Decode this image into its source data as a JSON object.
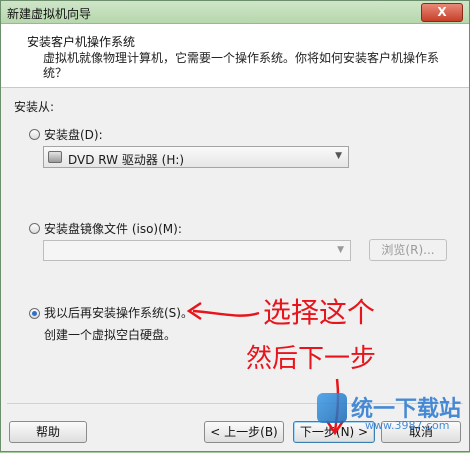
{
  "window": {
    "title": "新建虚拟机向导",
    "close_label": "X"
  },
  "header": {
    "title": "安装客户机操作系统",
    "description": "虚拟机就像物理计算机，它需要一个操作系统。你将如何安装客户机操作系统？"
  },
  "install_from": {
    "label": "安装从:",
    "disc_option": {
      "label": "安装盘(D):",
      "checked": false
    },
    "disc_drive": {
      "selected": "DVD RW 驱动器 (H:)"
    },
    "iso_option": {
      "label": "安装盘镜像文件 (iso)(M):",
      "checked": false
    },
    "iso_input": {
      "value": ""
    },
    "browse_label": "浏览(R)...",
    "later_option": {
      "label": "我以后再安装操作系统(S)。",
      "checked": true
    },
    "later_hint": "创建一个虚拟空白硬盘。"
  },
  "footer": {
    "help_label": "帮助",
    "back_label": "< 上一步(B)",
    "next_label": "下一步(N) >",
    "cancel_label": "取消"
  },
  "annotations": {
    "line1": "选择这个",
    "line2": "然后下一步"
  },
  "watermark": {
    "brand": "统一下载站",
    "url": "www.3987.com"
  },
  "colors": {
    "annotation": "#e8141b",
    "accent": "#2d6fd0",
    "titlebar": "#b6d7ad"
  }
}
